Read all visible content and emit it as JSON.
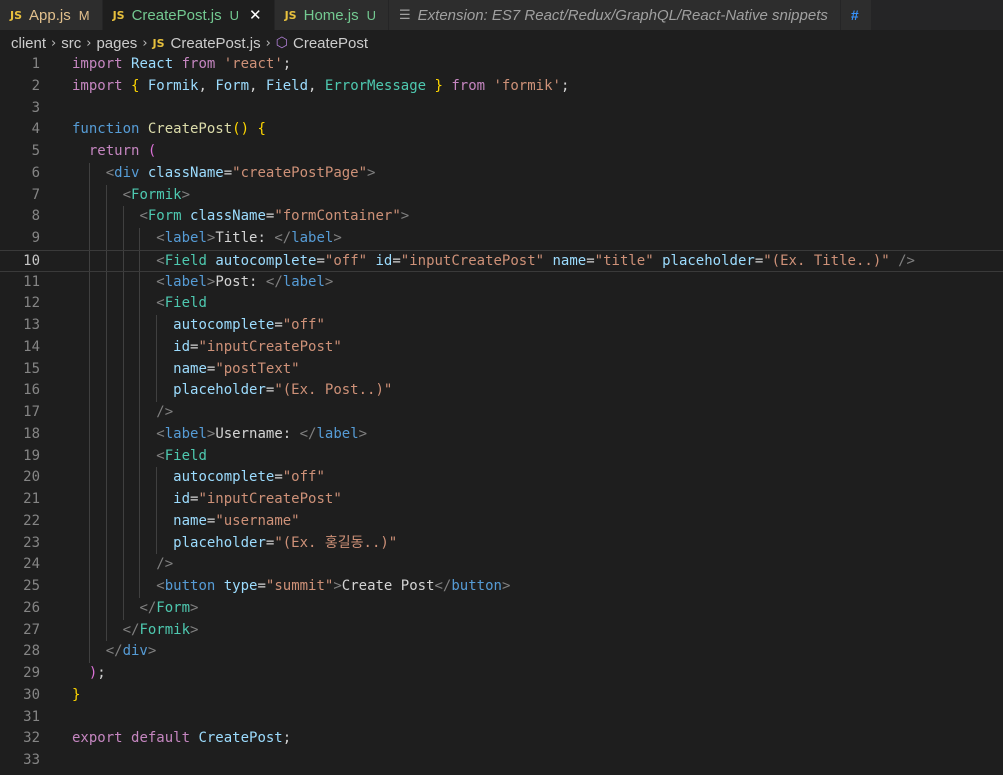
{
  "tabs": [
    {
      "label": "App.js",
      "badge": "M",
      "state": "modified"
    },
    {
      "label": "CreatePost.js",
      "badge": "U",
      "state": "untracked",
      "active": true,
      "close": "✕"
    },
    {
      "label": "Home.js",
      "badge": "U",
      "state": "untracked"
    },
    {
      "label": "Extension: ES7 React/Redux/GraphQL/React-Native snippets",
      "state": "extension"
    },
    {
      "label": "#",
      "state": "overflow"
    }
  ],
  "breadcrumb": [
    "client",
    "src",
    "pages",
    "CreatePost.js",
    "CreatePost"
  ],
  "icons": {
    "js_label": "JS"
  },
  "current_line": 10,
  "lines": [
    [
      [
        "import ",
        "t-kw"
      ],
      [
        "React ",
        "t-var"
      ],
      [
        "from ",
        "t-kw"
      ],
      [
        "'react'",
        "t-str"
      ],
      [
        ";",
        "t-def"
      ]
    ],
    [
      [
        "import ",
        "t-kw"
      ],
      [
        "{ ",
        "t-yel"
      ],
      [
        "Formik",
        "t-var"
      ],
      [
        ", ",
        "t-def"
      ],
      [
        "Form",
        "t-var"
      ],
      [
        ", ",
        "t-def"
      ],
      [
        "Field",
        "t-var"
      ],
      [
        ", ",
        "t-def"
      ],
      [
        "ErrorMessage ",
        "t-cmp"
      ],
      [
        "} ",
        "t-yel"
      ],
      [
        "from ",
        "t-kw"
      ],
      [
        "'formik'",
        "t-str"
      ],
      [
        ";",
        "t-def"
      ]
    ],
    [],
    [
      [
        "function ",
        "t-tag"
      ],
      [
        "CreatePost",
        "t-fn"
      ],
      [
        "() ",
        "t-yel"
      ],
      [
        "{",
        "t-yel"
      ]
    ],
    [
      [
        "  ",
        "t-def"
      ],
      [
        "return ",
        "t-kw"
      ],
      [
        "(",
        "t-pnk"
      ]
    ],
    [
      [
        "    ",
        "t-def"
      ],
      [
        "<",
        "t-br"
      ],
      [
        "div ",
        "t-tag"
      ],
      [
        "className",
        "t-attr"
      ],
      [
        "=",
        "t-def"
      ],
      [
        "\"createPostPage\"",
        "t-str"
      ],
      [
        ">",
        "t-br"
      ]
    ],
    [
      [
        "      ",
        "t-def"
      ],
      [
        "<",
        "t-br"
      ],
      [
        "Formik",
        "t-cmp"
      ],
      [
        ">",
        "t-br"
      ]
    ],
    [
      [
        "        ",
        "t-def"
      ],
      [
        "<",
        "t-br"
      ],
      [
        "Form ",
        "t-cmp"
      ],
      [
        "className",
        "t-attr"
      ],
      [
        "=",
        "t-def"
      ],
      [
        "\"formContainer\"",
        "t-str"
      ],
      [
        ">",
        "t-br"
      ]
    ],
    [
      [
        "          ",
        "t-def"
      ],
      [
        "<",
        "t-br"
      ],
      [
        "label",
        "t-tag"
      ],
      [
        ">",
        "t-br"
      ],
      [
        "Title: ",
        "t-def"
      ],
      [
        "</",
        "t-br"
      ],
      [
        "label",
        "t-tag"
      ],
      [
        ">",
        "t-br"
      ]
    ],
    [
      [
        "          ",
        "t-def"
      ],
      [
        "<",
        "t-br"
      ],
      [
        "Field ",
        "t-cmp"
      ],
      [
        "autocomplete",
        "t-attr"
      ],
      [
        "=",
        "t-def"
      ],
      [
        "\"off\" ",
        "t-str"
      ],
      [
        "id",
        "t-attr"
      ],
      [
        "=",
        "t-def"
      ],
      [
        "\"inputCreatePost\" ",
        "t-str"
      ],
      [
        "name",
        "t-attr"
      ],
      [
        "=",
        "t-def"
      ],
      [
        "\"title\" ",
        "t-str"
      ],
      [
        "placeholder",
        "t-attr"
      ],
      [
        "=",
        "t-def"
      ],
      [
        "\"(Ex. Title..)\" ",
        "t-str"
      ],
      [
        "/>",
        "t-br"
      ]
    ],
    [
      [
        "          ",
        "t-def"
      ],
      [
        "<",
        "t-br"
      ],
      [
        "label",
        "t-tag"
      ],
      [
        ">",
        "t-br"
      ],
      [
        "Post: ",
        "t-def"
      ],
      [
        "</",
        "t-br"
      ],
      [
        "label",
        "t-tag"
      ],
      [
        ">",
        "t-br"
      ]
    ],
    [
      [
        "          ",
        "t-def"
      ],
      [
        "<",
        "t-br"
      ],
      [
        "Field",
        "t-cmp"
      ]
    ],
    [
      [
        "            ",
        "t-def"
      ],
      [
        "autocomplete",
        "t-attr"
      ],
      [
        "=",
        "t-def"
      ],
      [
        "\"off\"",
        "t-str"
      ]
    ],
    [
      [
        "            ",
        "t-def"
      ],
      [
        "id",
        "t-attr"
      ],
      [
        "=",
        "t-def"
      ],
      [
        "\"inputCreatePost\"",
        "t-str"
      ]
    ],
    [
      [
        "            ",
        "t-def"
      ],
      [
        "name",
        "t-attr"
      ],
      [
        "=",
        "t-def"
      ],
      [
        "\"postText\"",
        "t-str"
      ]
    ],
    [
      [
        "            ",
        "t-def"
      ],
      [
        "placeholder",
        "t-attr"
      ],
      [
        "=",
        "t-def"
      ],
      [
        "\"(Ex. Post..)\"",
        "t-str"
      ]
    ],
    [
      [
        "          ",
        "t-def"
      ],
      [
        "/>",
        "t-br"
      ]
    ],
    [
      [
        "          ",
        "t-def"
      ],
      [
        "<",
        "t-br"
      ],
      [
        "label",
        "t-tag"
      ],
      [
        ">",
        "t-br"
      ],
      [
        "Username: ",
        "t-def"
      ],
      [
        "</",
        "t-br"
      ],
      [
        "label",
        "t-tag"
      ],
      [
        ">",
        "t-br"
      ]
    ],
    [
      [
        "          ",
        "t-def"
      ],
      [
        "<",
        "t-br"
      ],
      [
        "Field",
        "t-cmp"
      ]
    ],
    [
      [
        "            ",
        "t-def"
      ],
      [
        "autocomplete",
        "t-attr"
      ],
      [
        "=",
        "t-def"
      ],
      [
        "\"off\"",
        "t-str"
      ]
    ],
    [
      [
        "            ",
        "t-def"
      ],
      [
        "id",
        "t-attr"
      ],
      [
        "=",
        "t-def"
      ],
      [
        "\"inputCreatePost\"",
        "t-str"
      ]
    ],
    [
      [
        "            ",
        "t-def"
      ],
      [
        "name",
        "t-attr"
      ],
      [
        "=",
        "t-def"
      ],
      [
        "\"username\"",
        "t-str"
      ]
    ],
    [
      [
        "            ",
        "t-def"
      ],
      [
        "placeholder",
        "t-attr"
      ],
      [
        "=",
        "t-def"
      ],
      [
        "\"(Ex. 홍길동..)\"",
        "t-str"
      ]
    ],
    [
      [
        "          ",
        "t-def"
      ],
      [
        "/>",
        "t-br"
      ]
    ],
    [
      [
        "          ",
        "t-def"
      ],
      [
        "<",
        "t-br"
      ],
      [
        "button ",
        "t-tag"
      ],
      [
        "type",
        "t-attr"
      ],
      [
        "=",
        "t-def"
      ],
      [
        "\"summit\"",
        "t-str"
      ],
      [
        ">",
        "t-br"
      ],
      [
        "Create Post",
        "t-def"
      ],
      [
        "</",
        "t-br"
      ],
      [
        "button",
        "t-tag"
      ],
      [
        ">",
        "t-br"
      ]
    ],
    [
      [
        "        ",
        "t-def"
      ],
      [
        "</",
        "t-br"
      ],
      [
        "Form",
        "t-cmp"
      ],
      [
        ">",
        "t-br"
      ]
    ],
    [
      [
        "      ",
        "t-def"
      ],
      [
        "</",
        "t-br"
      ],
      [
        "Formik",
        "t-cmp"
      ],
      [
        ">",
        "t-br"
      ]
    ],
    [
      [
        "    ",
        "t-def"
      ],
      [
        "</",
        "t-br"
      ],
      [
        "div",
        "t-tag"
      ],
      [
        ">",
        "t-br"
      ]
    ],
    [
      [
        "  ",
        "t-def"
      ],
      [
        ")",
        "t-pnk"
      ],
      [
        ";",
        "t-def"
      ]
    ],
    [
      [
        "}",
        "t-yel"
      ]
    ],
    [],
    [
      [
        "export ",
        "t-kw"
      ],
      [
        "default ",
        "t-kw"
      ],
      [
        "CreatePost",
        "t-var"
      ],
      [
        ";",
        "t-def"
      ]
    ],
    []
  ]
}
